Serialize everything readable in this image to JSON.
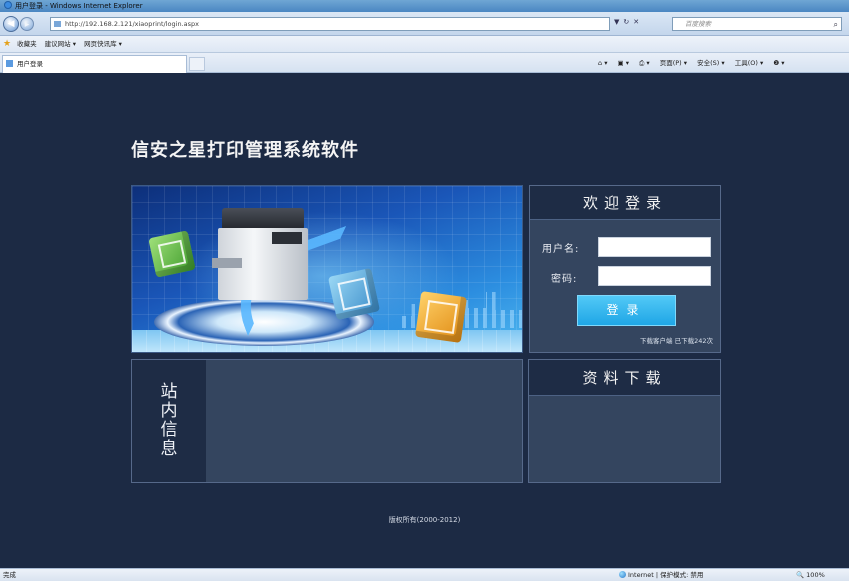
{
  "window": {
    "title": "用户登录 - Windows Internet Explorer",
    "url": "http://192.168.2.121/xiaoprint/login.aspx",
    "search_placeholder": "百度搜索",
    "favorites_label": "收藏夹",
    "fav_links": [
      "建议网站 ▾",
      "网页快讯库 ▾"
    ],
    "tab_title": "用户登录",
    "commands": [
      "页面(P) ▾",
      "安全(S) ▾",
      "工具(O) ▾",
      "❷ ▾"
    ]
  },
  "page": {
    "system_title": "信安之星打印管理系统软件",
    "login": {
      "header": "欢迎登录",
      "username_label": "用户名:",
      "username_value": "",
      "password_label": "密码:",
      "password_value": "",
      "submit_label": "登录",
      "download_client": "下载客户端  已下载242次"
    },
    "news": {
      "side_title": [
        "站",
        "内",
        "信",
        "息"
      ]
    },
    "downloads": {
      "header": "资料下载"
    },
    "copyright": "版权所有(2000-2012)"
  },
  "status": {
    "left": "完成",
    "zone": "Internet | 保护模式: 禁用",
    "zoom": "100%"
  }
}
